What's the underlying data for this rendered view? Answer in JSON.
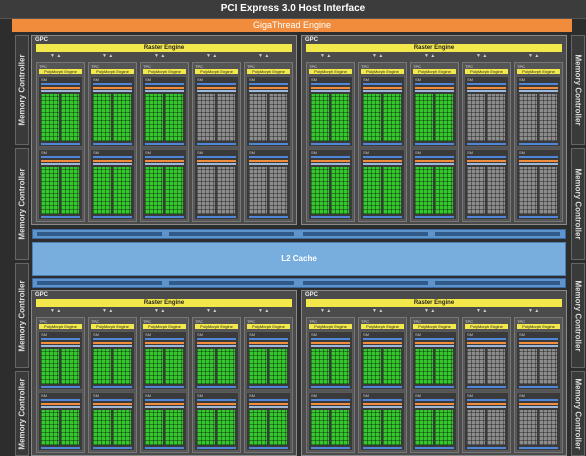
{
  "title": "PCI Express 3.0 Host Interface",
  "giga_thread": "GigaThread Engine",
  "l2_cache": "L2 Cache",
  "memory_controller": "Memory Controller",
  "gpc_label": "GPC",
  "raster_engine": "Raster Engine",
  "tpc_label": "TPC",
  "polymorph_engine": "PolyMorph Engine",
  "sm_label": "SM",
  "colors": {
    "background": "#2d2d2d",
    "gigathread": "#f08c3c",
    "raster": "#f2e84c",
    "cuda_core": "#35c82e",
    "disabled_core": "#8c8c8c",
    "l2": "#77aede",
    "crossbar": "#5f93cc",
    "scheduler": "#4f86d8",
    "register": "#f08c3c"
  },
  "gpcs": [
    {
      "name": "gpc-top-left",
      "disabled_tpcs": [
        3,
        4
      ]
    },
    {
      "name": "gpc-top-right",
      "disabled_tpcs": [
        3,
        4
      ]
    },
    {
      "name": "gpc-bottom-left",
      "disabled_tpcs": []
    },
    {
      "name": "gpc-bottom-right",
      "disabled_tpcs": [
        3,
        4
      ]
    }
  ]
}
